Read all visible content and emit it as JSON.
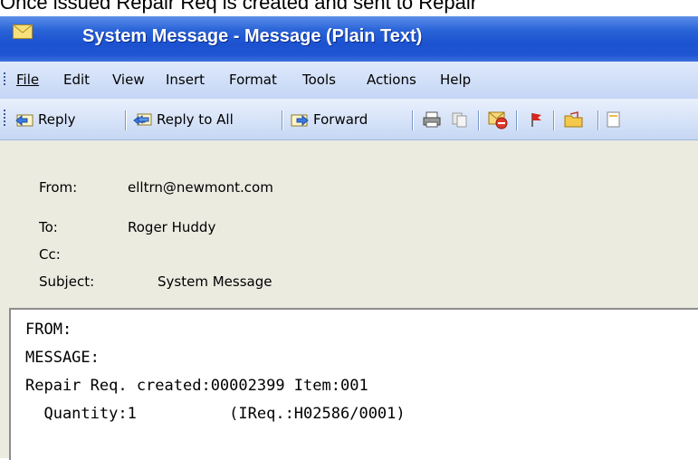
{
  "caption": "Once issued Repair Req is created and sent to Repair",
  "window": {
    "title": "System Message - Message (Plain Text)"
  },
  "menu": [
    "File",
    "Edit",
    "View",
    "Insert",
    "Format",
    "Tools",
    "Actions",
    "Help"
  ],
  "toolbar": {
    "reply": "Reply",
    "reply_all": "Reply to All",
    "forward": "Forward"
  },
  "header": {
    "from_label": "From:",
    "from_value": "elltrn@newmont.com",
    "to_label": "To:",
    "to_value": "Roger Huddy",
    "cc_label": "Cc:",
    "cc_value": "",
    "subject_label": "Subject:",
    "subject_value": "System Message"
  },
  "body": {
    "lines": [
      "FROM:",
      "MESSAGE:",
      "Repair Req. created:00002399 Item:001",
      "  Quantity:1          (IReq.:H02586/0001)"
    ]
  }
}
